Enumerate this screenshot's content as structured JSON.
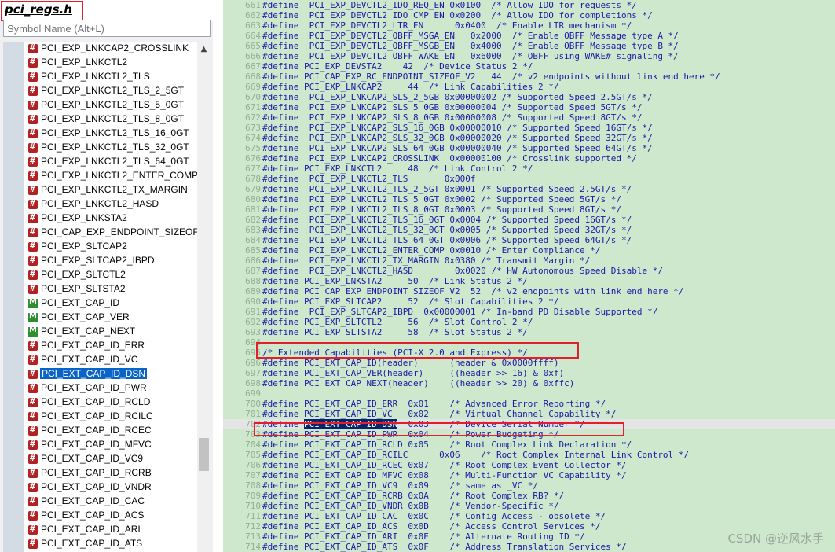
{
  "file_title": "pci_regs.h",
  "search": {
    "placeholder": "Symbol Name (Alt+L)",
    "value": ""
  },
  "symbols": [
    {
      "label": "PCI_EXP_LNKCAP2_CROSSLINK",
      "icon": "hash"
    },
    {
      "label": "PCI_EXP_LNKCTL2",
      "icon": "hash"
    },
    {
      "label": "PCI_EXP_LNKCTL2_TLS",
      "icon": "hash"
    },
    {
      "label": "PCI_EXP_LNKCTL2_TLS_2_5GT",
      "icon": "hash"
    },
    {
      "label": "PCI_EXP_LNKCTL2_TLS_5_0GT",
      "icon": "hash"
    },
    {
      "label": "PCI_EXP_LNKCTL2_TLS_8_0GT",
      "icon": "hash"
    },
    {
      "label": "PCI_EXP_LNKCTL2_TLS_16_0GT",
      "icon": "hash"
    },
    {
      "label": "PCI_EXP_LNKCTL2_TLS_32_0GT",
      "icon": "hash"
    },
    {
      "label": "PCI_EXP_LNKCTL2_TLS_64_0GT",
      "icon": "hash"
    },
    {
      "label": "PCI_EXP_LNKCTL2_ENTER_COMP",
      "icon": "hash"
    },
    {
      "label": "PCI_EXP_LNKCTL2_TX_MARGIN",
      "icon": "hash"
    },
    {
      "label": "PCI_EXP_LNKCTL2_HASD",
      "icon": "hash"
    },
    {
      "label": "PCI_EXP_LNKSTA2",
      "icon": "hash"
    },
    {
      "label": "PCI_CAP_EXP_ENDPOINT_SIZEOF_V",
      "icon": "hash"
    },
    {
      "label": "PCI_EXP_SLTCAP2",
      "icon": "hash"
    },
    {
      "label": "PCI_EXP_SLTCAP2_IBPD",
      "icon": "hash"
    },
    {
      "label": "PCI_EXP_SLTCTL2",
      "icon": "hash"
    },
    {
      "label": "PCI_EXP_SLTSTA2",
      "icon": "hash"
    },
    {
      "label": "PCI_EXT_CAP_ID",
      "icon": "macro"
    },
    {
      "label": "PCI_EXT_CAP_VER",
      "icon": "macro"
    },
    {
      "label": "PCI_EXT_CAP_NEXT",
      "icon": "macro"
    },
    {
      "label": "PCI_EXT_CAP_ID_ERR",
      "icon": "hash"
    },
    {
      "label": "PCI_EXT_CAP_ID_VC",
      "icon": "hash"
    },
    {
      "label": "PCI_EXT_CAP_ID_DSN",
      "icon": "hash",
      "selected": true
    },
    {
      "label": "PCI_EXT_CAP_ID_PWR",
      "icon": "hash"
    },
    {
      "label": "PCI_EXT_CAP_ID_RCLD",
      "icon": "hash"
    },
    {
      "label": "PCI_EXT_CAP_ID_RCILC",
      "icon": "hash"
    },
    {
      "label": "PCI_EXT_CAP_ID_RCEC",
      "icon": "hash"
    },
    {
      "label": "PCI_EXT_CAP_ID_MFVC",
      "icon": "hash"
    },
    {
      "label": "PCI_EXT_CAP_ID_VC9",
      "icon": "hash"
    },
    {
      "label": "PCI_EXT_CAP_ID_RCRB",
      "icon": "hash"
    },
    {
      "label": "PCI_EXT_CAP_ID_VNDR",
      "icon": "hash"
    },
    {
      "label": "PCI_EXT_CAP_ID_CAC",
      "icon": "hash"
    },
    {
      "label": "PCI_EXT_CAP_ID_ACS",
      "icon": "hash"
    },
    {
      "label": "PCI_EXT_CAP_ID_ARI",
      "icon": "hash"
    },
    {
      "label": "PCI_EXT_CAP_ID_ATS",
      "icon": "hash"
    }
  ],
  "code_lines": [
    {
      "num": "661",
      "text": "#define  PCI_EXP_DEVCTL2_IDO_REQ_EN 0x0100  /* Allow IDO for requests */"
    },
    {
      "num": "662",
      "text": "#define  PCI_EXP_DEVCTL2_IDO_CMP_EN 0x0200  /* Allow IDO for completions */"
    },
    {
      "num": "663",
      "text": "#define  PCI_EXP_DEVCTL2_LTR_EN      0x0400  /* Enable LTR mechanism */"
    },
    {
      "num": "664",
      "text": "#define  PCI_EXP_DEVCTL2_OBFF_MSGA_EN   0x2000  /* Enable OBFF Message type A */"
    },
    {
      "num": "665",
      "text": "#define  PCI_EXP_DEVCTL2_OBFF_MSGB_EN   0x4000  /* Enable OBFF Message type B */"
    },
    {
      "num": "666",
      "text": "#define  PCI_EXP_DEVCTL2_OBFF_WAKE_EN   0x6000  /* OBFF using WAKE# signaling */"
    },
    {
      "num": "667",
      "text": "#define PCI_EXP_DEVSTA2    42  /* Device Status 2 */"
    },
    {
      "num": "668",
      "text": "#define PCI_CAP_EXP_RC_ENDPOINT_SIZEOF_V2   44  /* v2 endpoints without link end here */"
    },
    {
      "num": "669",
      "text": "#define PCI_EXP_LNKCAP2     44  /* Link Capabilities 2 */"
    },
    {
      "num": "670",
      "text": "#define  PCI_EXP_LNKCAP2_SLS_2_5GB 0x00000002 /* Supported Speed 2.5GT/s */"
    },
    {
      "num": "671",
      "text": "#define  PCI_EXP_LNKCAP2_SLS_5_0GB 0x00000004 /* Supported Speed 5GT/s */"
    },
    {
      "num": "672",
      "text": "#define  PCI_EXP_LNKCAP2_SLS_8_0GB 0x00000008 /* Supported Speed 8GT/s */"
    },
    {
      "num": "673",
      "text": "#define  PCI_EXP_LNKCAP2_SLS_16_0GB 0x00000010 /* Supported Speed 16GT/s */"
    },
    {
      "num": "674",
      "text": "#define  PCI_EXP_LNKCAP2_SLS_32_0GB 0x00000020 /* Supported Speed 32GT/s */"
    },
    {
      "num": "675",
      "text": "#define  PCI_EXP_LNKCAP2_SLS_64_0GB 0x00000040 /* Supported Speed 64GT/s */"
    },
    {
      "num": "676",
      "text": "#define  PCI_EXP_LNKCAP2_CROSSLINK  0x00000100 /* Crosslink supported */"
    },
    {
      "num": "677",
      "text": "#define PCI_EXP_LNKCTL2     48  /* Link Control 2 */"
    },
    {
      "num": "678",
      "text": "#define  PCI_EXP_LNKCTL2_TLS       0x000f"
    },
    {
      "num": "679",
      "text": "#define  PCI_EXP_LNKCTL2_TLS_2_5GT 0x0001 /* Supported Speed 2.5GT/s */"
    },
    {
      "num": "680",
      "text": "#define  PCI_EXP_LNKCTL2_TLS_5_0GT 0x0002 /* Supported Speed 5GT/s */"
    },
    {
      "num": "681",
      "text": "#define  PCI_EXP_LNKCTL2_TLS_8_0GT 0x0003 /* Supported Speed 8GT/s */"
    },
    {
      "num": "682",
      "text": "#define  PCI_EXP_LNKCTL2_TLS_16_0GT 0x0004 /* Supported Speed 16GT/s */"
    },
    {
      "num": "683",
      "text": "#define  PCI_EXP_LNKCTL2_TLS_32_0GT 0x0005 /* Supported Speed 32GT/s */"
    },
    {
      "num": "684",
      "text": "#define  PCI_EXP_LNKCTL2_TLS_64_0GT 0x0006 /* Supported Speed 64GT/s */"
    },
    {
      "num": "685",
      "text": "#define  PCI_EXP_LNKCTL2_ENTER_COMP 0x0010 /* Enter Compliance */"
    },
    {
      "num": "686",
      "text": "#define  PCI_EXP_LNKCTL2_TX_MARGIN 0x0380 /* Transmit Margin */"
    },
    {
      "num": "687",
      "text": "#define  PCI_EXP_LNKCTL2_HASD        0x0020 /* HW Autonomous Speed Disable */"
    },
    {
      "num": "688",
      "text": "#define PCI_EXP_LNKSTA2     50  /* Link Status 2 */"
    },
    {
      "num": "689",
      "text": "#define PCI_CAP_EXP_ENDPOINT_SIZEOF_V2  52  /* v2 endpoints with link end here */"
    },
    {
      "num": "690",
      "text": "#define PCI_EXP_SLTCAP2     52  /* Slot Capabilities 2 */"
    },
    {
      "num": "691",
      "text": "#define  PCI_EXP_SLTCAP2_IBPD  0x00000001 /* In-band PD Disable Supported */"
    },
    {
      "num": "692",
      "text": "#define PCI_EXP_SLTCTL2     56  /* Slot Control 2 */"
    },
    {
      "num": "693",
      "text": "#define PCI_EXP_SLTSTA2     58  /* Slot Status 2 */"
    },
    {
      "num": "694",
      "text": ""
    },
    {
      "num": "695",
      "text": "/* Extended Capabilities (PCI-X 2.0 and Express) */"
    },
    {
      "num": "696",
      "text": "#define PCI_EXT_CAP_ID(header)      (header & 0x0000ffff)"
    },
    {
      "num": "697",
      "text": "#define PCI_EXT_CAP_VER(header)     ((header >> 16) & 0xf)"
    },
    {
      "num": "698",
      "text": "#define PCI_EXT_CAP_NEXT(header)    ((header >> 20) & 0xffc)"
    },
    {
      "num": "699",
      "text": ""
    },
    {
      "num": "700",
      "text": "#define PCI_EXT_CAP_ID_ERR  0x01    /* Advanced Error Reporting */"
    },
    {
      "num": "701",
      "text": "#define PCI_EXT_CAP_ID_VC   0x02    /* Virtual Channel Capability */"
    },
    {
      "num": "702",
      "text": "#define PCI_EXT_CAP_ID_DSN  0x03    /* Device Serial Number */"
    },
    {
      "num": "703",
      "text": "#define PCI_EXT_CAP_ID_PWR  0x04    /* Power Budgeting */"
    },
    {
      "num": "704",
      "text": "#define PCI_EXT_CAP_ID_RCLD 0x05    /* Root Complex Link Declaration */"
    },
    {
      "num": "705",
      "text": "#define PCI_EXT_CAP_ID_RCILC      0x06    /* Root Complex Internal Link Control */"
    },
    {
      "num": "706",
      "text": "#define PCI_EXT_CAP_ID_RCEC 0x07    /* Root Complex Event Collector */"
    },
    {
      "num": "707",
      "text": "#define PCI_EXT_CAP_ID_MFVC 0x08    /* Multi-Function VC Capability */"
    },
    {
      "num": "708",
      "text": "#define PCI_EXT_CAP_ID_VC9  0x09    /* same as _VC */"
    },
    {
      "num": "709",
      "text": "#define PCI_EXT_CAP_ID_RCRB 0x0A    /* Root Complex RB? */"
    },
    {
      "num": "710",
      "text": "#define PCI_EXT_CAP_ID_VNDR 0x0B    /* Vendor-Specific */"
    },
    {
      "num": "711",
      "text": "#define PCI_EXT_CAP_ID_CAC  0x0C    /* Config Access - obsolete */"
    },
    {
      "num": "712",
      "text": "#define PCI_EXT_CAP_ID_ACS  0x0D    /* Access Control Services */"
    },
    {
      "num": "713",
      "text": "#define PCI_EXT_CAP_ID_ARI  0x0E    /* Alternate Routing ID */"
    },
    {
      "num": "714",
      "text": "#define PCI_EXT_CAP_ID_ATS  0x0F    /* Address Translation Services */"
    }
  ],
  "current_line": "702",
  "highlight_symbol": "PCI_EXT_CAP_ID_DSN",
  "watermark": "CSDN @逆风水手",
  "colors": {
    "editor_bg": "#cde8cd",
    "selection": "#0a64c8",
    "annotation": "#e0202a"
  }
}
